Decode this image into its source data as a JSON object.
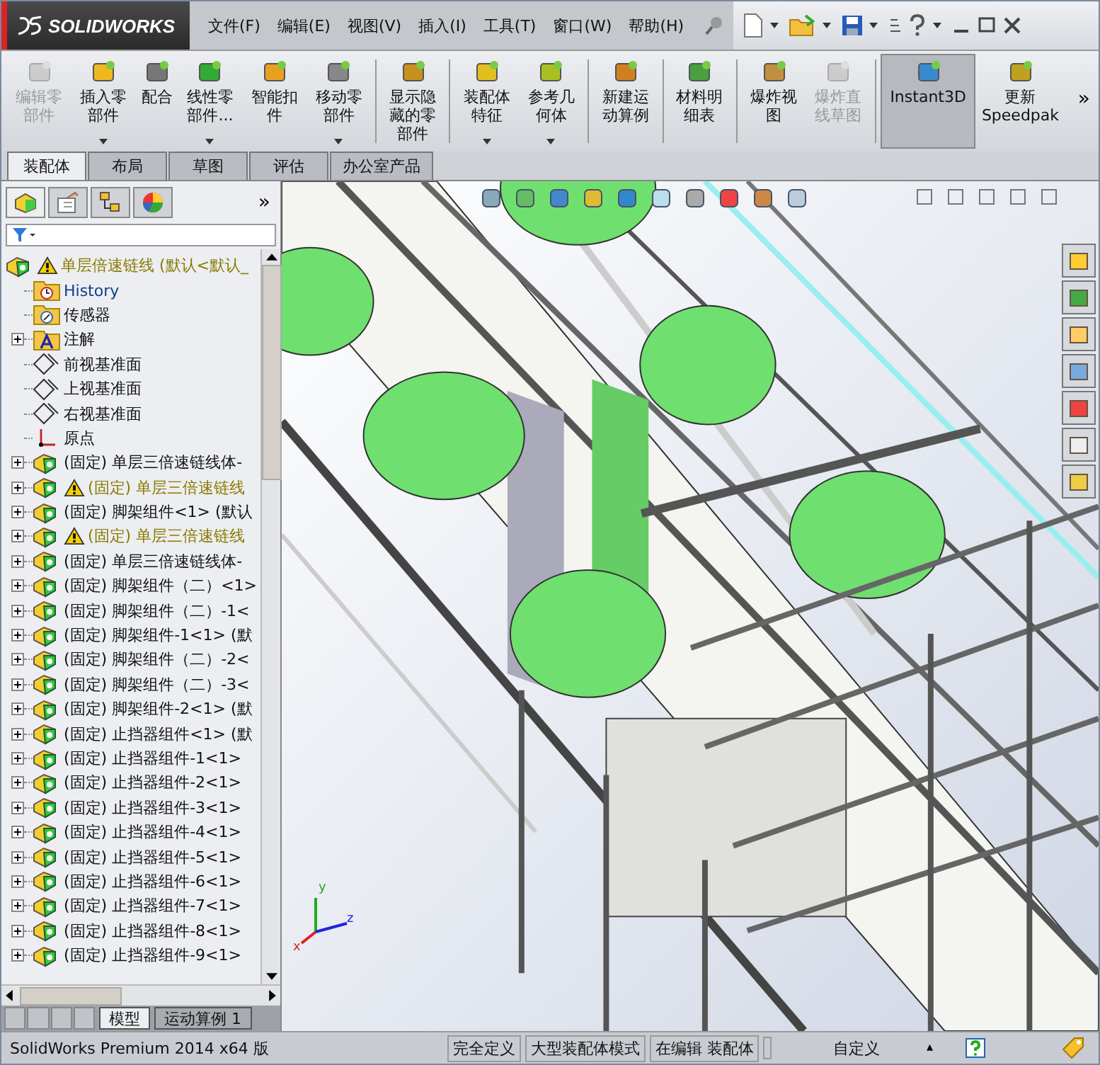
{
  "app": {
    "logo": "SOLIDWORKS"
  },
  "menu": [
    "文件(F)",
    "编辑(E)",
    "视图(V)",
    "插入(I)",
    "工具(T)",
    "窗口(W)",
    "帮助(H)"
  ],
  "toolbar": {
    "groups": [
      [
        {
          "label": "编辑零部件",
          "disabled": true,
          "dropdown": false,
          "selected": false
        },
        {
          "label": "插入零部件",
          "disabled": false,
          "dropdown": true,
          "selected": false
        },
        {
          "label": "配合",
          "disabled": false,
          "dropdown": false,
          "selected": false
        },
        {
          "label": "线性零部件...",
          "disabled": false,
          "dropdown": true,
          "selected": false
        },
        {
          "label": "智能扣件",
          "disabled": false,
          "dropdown": false,
          "selected": false
        },
        {
          "label": "移动零部件",
          "disabled": false,
          "dropdown": true,
          "selected": false
        }
      ],
      [
        {
          "label": "显示隐藏的零部件",
          "disabled": false,
          "dropdown": false,
          "selected": false
        }
      ],
      [
        {
          "label": "装配体特征",
          "disabled": false,
          "dropdown": true,
          "selected": false
        },
        {
          "label": "参考几何体",
          "disabled": false,
          "dropdown": true,
          "selected": false
        }
      ],
      [
        {
          "label": "新建运动算例",
          "disabled": false,
          "dropdown": false,
          "selected": false
        }
      ],
      [
        {
          "label": "材料明细表",
          "disabled": false,
          "dropdown": false,
          "selected": false
        }
      ],
      [
        {
          "label": "爆炸视图",
          "disabled": false,
          "dropdown": false,
          "selected": false
        },
        {
          "label": "爆炸直线草图",
          "disabled": true,
          "dropdown": false,
          "selected": false
        }
      ],
      [
        {
          "label": "Instant3D",
          "disabled": false,
          "dropdown": false,
          "selected": true
        },
        {
          "label": "更新 Speedpak",
          "disabled": false,
          "dropdown": false,
          "selected": false
        }
      ]
    ],
    "more": "»"
  },
  "tabs": [
    {
      "label": "装配体",
      "selected": true
    },
    {
      "label": "布局",
      "selected": false
    },
    {
      "label": "草图",
      "selected": false
    },
    {
      "label": "评估",
      "selected": false
    },
    {
      "label": "办公室产品",
      "selected": false
    }
  ],
  "panel_more": "»",
  "tree": {
    "label": "单层倍速链线 (默认<默认_",
    "kind": "assembly",
    "warning": true,
    "children": [
      {
        "label": "History",
        "kind": "history",
        "warning": false,
        "collapsed": false
      },
      {
        "label": "传感器",
        "kind": "sensor",
        "warning": false,
        "collapsed": false
      },
      {
        "label": "注解",
        "kind": "annotation",
        "warning": false,
        "collapsed": true
      },
      {
        "label": "前视基准面",
        "kind": "plane",
        "warning": false,
        "collapsed": false
      },
      {
        "label": "上视基准面",
        "kind": "plane",
        "warning": false,
        "collapsed": false
      },
      {
        "label": "右视基准面",
        "kind": "plane",
        "warning": false,
        "collapsed": false
      },
      {
        "label": "原点",
        "kind": "origin",
        "warning": false,
        "collapsed": false
      },
      {
        "label": "(固定) 单层三倍速链线体-",
        "kind": "part",
        "warning": false,
        "collapsed": true
      },
      {
        "label": "(固定) 单层三倍速链线",
        "kind": "part",
        "warning": true,
        "collapsed": true
      },
      {
        "label": "(固定) 脚架组件<1> (默认",
        "kind": "part",
        "warning": false,
        "collapsed": true
      },
      {
        "label": "(固定) 单层三倍速链线",
        "kind": "part",
        "warning": true,
        "collapsed": true
      },
      {
        "label": "(固定) 单层三倍速链线体-",
        "kind": "part",
        "warning": false,
        "collapsed": true
      },
      {
        "label": "(固定) 脚架组件（二）<1>",
        "kind": "part",
        "warning": false,
        "collapsed": true
      },
      {
        "label": "(固定) 脚架组件（二）-1<",
        "kind": "part",
        "warning": false,
        "collapsed": true
      },
      {
        "label": "(固定) 脚架组件-1<1> (默",
        "kind": "part",
        "warning": false,
        "collapsed": true
      },
      {
        "label": "(固定) 脚架组件（二）-2<",
        "kind": "part",
        "warning": false,
        "collapsed": true
      },
      {
        "label": "(固定) 脚架组件（二）-3<",
        "kind": "part",
        "warning": false,
        "collapsed": true
      },
      {
        "label": "(固定) 脚架组件-2<1> (默",
        "kind": "part",
        "warning": false,
        "collapsed": true
      },
      {
        "label": "(固定) 止挡器组件<1> (默",
        "kind": "part",
        "warning": false,
        "collapsed": true
      },
      {
        "label": "(固定) 止挡器组件-1<1>",
        "kind": "part",
        "warning": false,
        "collapsed": true
      },
      {
        "label": "(固定) 止挡器组件-2<1>",
        "kind": "part",
        "warning": false,
        "collapsed": true
      },
      {
        "label": "(固定) 止挡器组件-3<1>",
        "kind": "part",
        "warning": false,
        "collapsed": true
      },
      {
        "label": "(固定) 止挡器组件-4<1>",
        "kind": "part",
        "warning": false,
        "collapsed": true
      },
      {
        "label": "(固定) 止挡器组件-5<1>",
        "kind": "part",
        "warning": false,
        "collapsed": true
      },
      {
        "label": "(固定) 止挡器组件-6<1>",
        "kind": "part",
        "warning": false,
        "collapsed": true
      },
      {
        "label": "(固定) 止挡器组件-7<1>",
        "kind": "part",
        "warning": false,
        "collapsed": true
      },
      {
        "label": "(固定) 止挡器组件-8<1>",
        "kind": "part",
        "warning": false,
        "collapsed": true
      },
      {
        "label": "(固定) 止挡器组件-9<1>",
        "kind": "part",
        "warning": false,
        "collapsed": true
      }
    ]
  },
  "bottom_tabs": [
    {
      "label": "模型",
      "selected": true
    },
    {
      "label": "运动算例 1",
      "selected": false
    }
  ],
  "triad": [
    "x",
    "y",
    "z"
  ],
  "status_bar": {
    "product": "SolidWorks Premium 2014 x64 版",
    "fields": [
      "完全定义",
      "大型装配体模式",
      "在编辑 装配体"
    ],
    "units": "自定义",
    "units_caret": "▴"
  }
}
